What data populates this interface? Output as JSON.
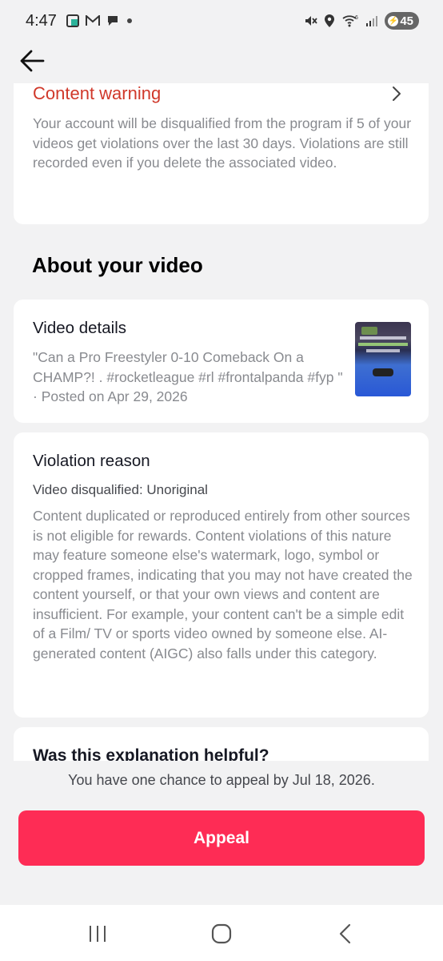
{
  "status_bar": {
    "time": "4:47",
    "battery": "45",
    "icons": [
      "gallery-icon",
      "gmail-icon",
      "chat-icon",
      "dot-icon",
      "mute-icon",
      "location-icon",
      "wifi-icon",
      "signal-icon",
      "battery-icon"
    ],
    "wifi_label": "6"
  },
  "header": {
    "back_icon": "arrow-left-icon"
  },
  "content_warning": {
    "title": "Content warning",
    "body": "Your account will be disqualified from the program if 5 of your videos get violations over the last 30 days. Violations are still recorded even if you delete the associated video."
  },
  "section_title": "About your video",
  "video_details": {
    "title": "Video details",
    "description": "\"Can a Pro Freestyler 0-10 Comeback On a CHAMP?! . #rocketleague #rl #frontalpanda #fyp \" · Posted on Apr 29, 2026"
  },
  "violation": {
    "title": "Violation reason",
    "subtitle": "Video disqualified: Unoriginal",
    "body": "Content duplicated or reproduced entirely from other sources is not eligible for rewards. Content violations of this nature may feature someone else's watermark, logo, symbol or cropped frames, indicating that you may not have created the content yourself, or that your own views and content are insufficient. For example, your content can't be a simple edit of a Film/ TV or sports video owned by someone else. AI-generated content (AIGC) also falls under this category."
  },
  "helpful": {
    "title": "Was this explanation helpful?"
  },
  "appeal": {
    "note": "You have one chance to appeal by Jul 18, 2026.",
    "button_label": "Appeal"
  },
  "colors": {
    "warning_red": "#d0382a",
    "appeal_pink": "#fe2c55",
    "page_bg": "#f2f2f3",
    "muted_text": "#888a8f"
  }
}
